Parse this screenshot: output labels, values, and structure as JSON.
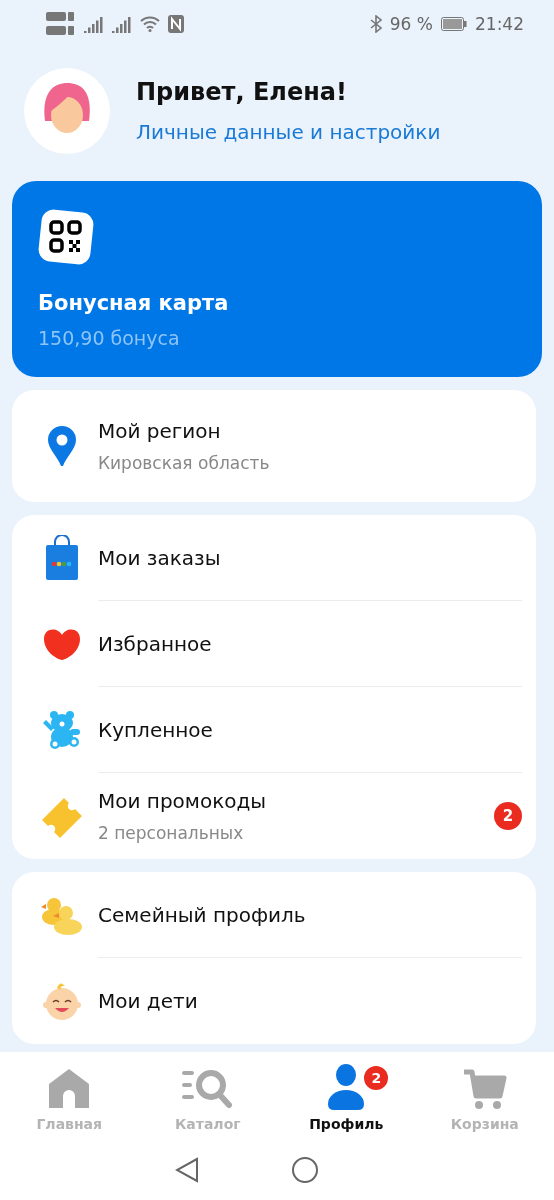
{
  "status_bar": {
    "battery": "96 %",
    "time": "21:42"
  },
  "header": {
    "greeting": "Привет, Елена!",
    "link": "Личные данные и настройки"
  },
  "bonus_card": {
    "title": "Бонусная карта",
    "subtitle": "150,90 бонуса"
  },
  "region": {
    "title": "Мой регион",
    "subtitle": "Кировская область"
  },
  "menu": [
    {
      "title": "Мои заказы"
    },
    {
      "title": "Избранное"
    },
    {
      "title": "Купленное"
    },
    {
      "title": "Мои промокоды",
      "subtitle": "2 персональных",
      "badge": "2"
    }
  ],
  "family_menu": [
    {
      "title": "Семейный профиль"
    },
    {
      "title": "Мои дети"
    }
  ],
  "tabs": [
    {
      "label": "Главная",
      "selected": false
    },
    {
      "label": "Каталог",
      "selected": false
    },
    {
      "label": "Профиль",
      "selected": true,
      "badge": "2"
    },
    {
      "label": "Корзина",
      "selected": false
    }
  ]
}
